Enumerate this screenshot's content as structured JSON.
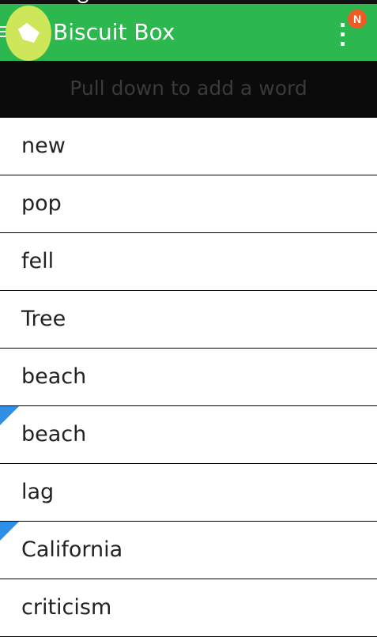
{
  "app": {
    "title": "Biscuit Box",
    "badge": "N",
    "accent_color": "#2db84f",
    "logo_color": "#cde65a",
    "badge_color": "#f15a24",
    "flag_color": "#2f8fe6"
  },
  "banner": {
    "text": "Pull down to add a word"
  },
  "words": [
    {
      "text": "new",
      "flagged": false
    },
    {
      "text": "pop",
      "flagged": false
    },
    {
      "text": "fell",
      "flagged": false
    },
    {
      "text": "Tree",
      "flagged": false
    },
    {
      "text": "beach",
      "flagged": false
    },
    {
      "text": "beach",
      "flagged": true
    },
    {
      "text": "lag",
      "flagged": false
    },
    {
      "text": "California",
      "flagged": true
    },
    {
      "text": "criticism",
      "flagged": false
    }
  ]
}
